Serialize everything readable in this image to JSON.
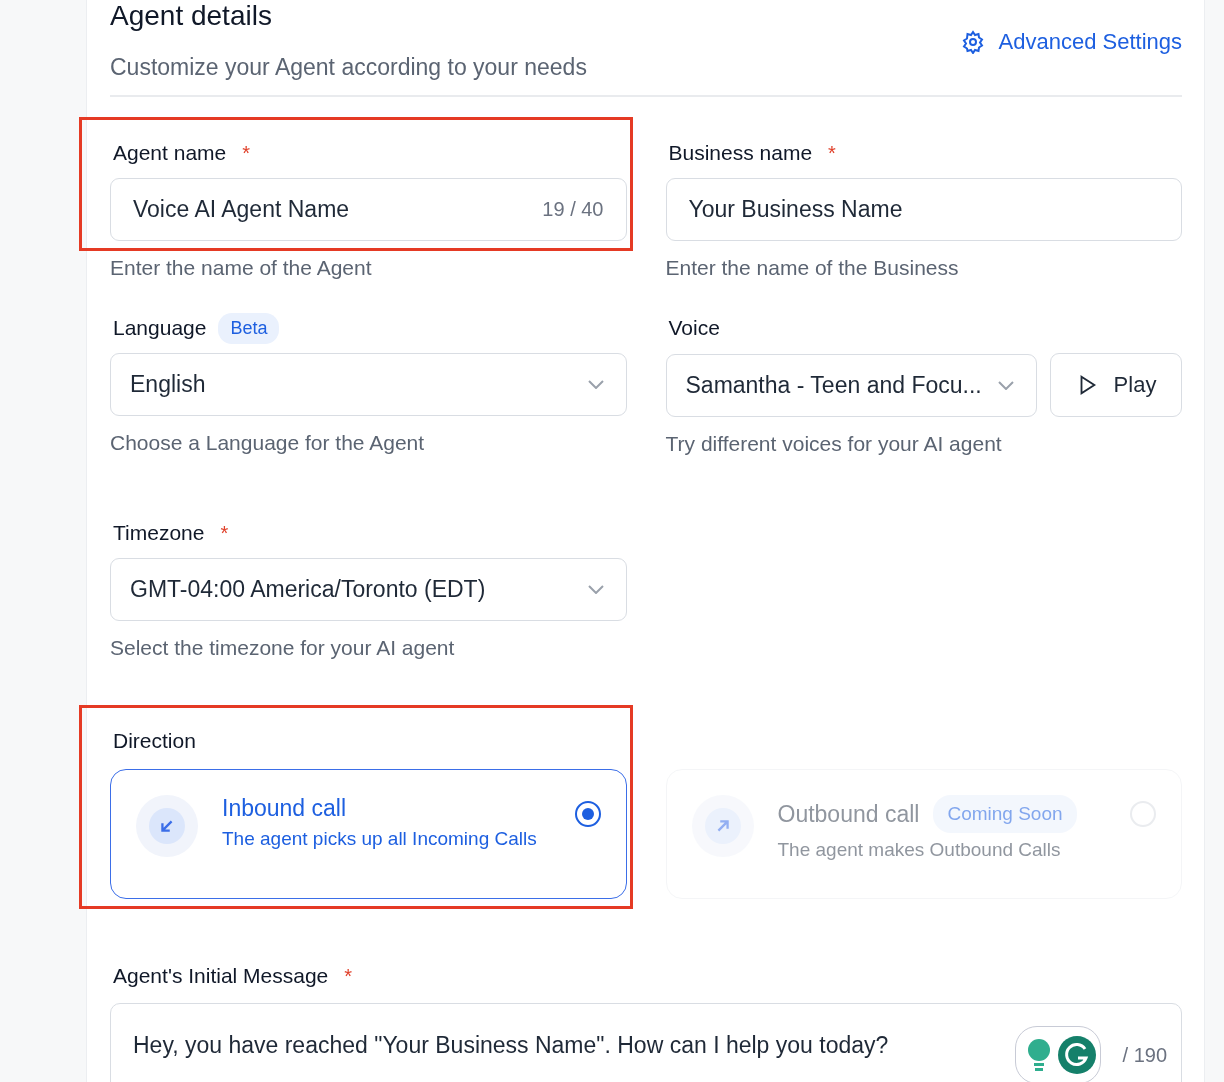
{
  "header": {
    "title": "Agent details",
    "subtitle": "Customize your Agent according to your needs",
    "action": "Advanced Settings"
  },
  "fields": [
    {
      "kind": "text",
      "label": "Agent name",
      "required_mark": "*",
      "highlighted": true,
      "value": "Voice AI Agent Name",
      "counter": "19 / 40",
      "help": "Enter the name of the Agent"
    },
    {
      "kind": "text",
      "label": "Business name",
      "required_mark": "*",
      "highlighted": false,
      "value": "Your Business Name",
      "help": "Enter the name of the Business"
    },
    {
      "kind": "select",
      "label": "Language",
      "badge": "Beta",
      "highlighted": false,
      "value": "English",
      "help": "Choose a Language for the Agent"
    },
    {
      "kind": "voice",
      "label": "Voice",
      "highlighted": false,
      "value": "Samantha - Teen and Focu...",
      "button": "Play",
      "help": "Try different voices for your AI agent"
    },
    {
      "kind": "select",
      "label": "Timezone",
      "required_mark": "*",
      "highlighted": false,
      "value": "GMT-04:00 America/Toronto (EDT)",
      "help": "Select the timezone for your AI agent"
    }
  ],
  "direction": {
    "label": "Direction",
    "highlighted": true,
    "options": [
      {
        "kind": "inbound",
        "title": "Inbound call",
        "description": "The agent picks up all Incoming Calls",
        "selected": true,
        "disabled": false
      },
      {
        "kind": "outbound",
        "title": "Outbound call",
        "badge": "Coming Soon",
        "description": "The agent makes Outbound Calls",
        "selected": false,
        "disabled": true
      }
    ]
  },
  "initial_message": {
    "label": "Agent's Initial Message",
    "required_mark": "*",
    "value": "Hey, you have reached \"Your Business Name\". How can I help you today?",
    "counter": "/ 190"
  }
}
